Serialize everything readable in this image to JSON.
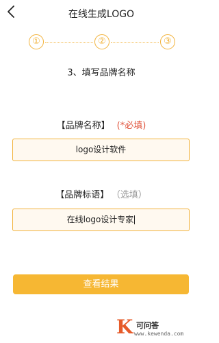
{
  "header": {
    "title": "在线生成LOGO",
    "back_icon": "chevron-left-icon"
  },
  "steps": {
    "items": [
      "①",
      "②",
      "③"
    ],
    "accent_color": "#f2b23a"
  },
  "step_title": "3、填写品牌名称",
  "brand_name": {
    "label": "【品牌名称】",
    "required_note": "(*必填)",
    "value": "logo设计软件"
  },
  "brand_slogan": {
    "label": "【品牌标语】",
    "optional_note": "（选填）",
    "value": "在线logo设计专家"
  },
  "submit": {
    "label": "查看结果",
    "color": "#f6b733"
  },
  "watermark": {
    "logo_letter": "K",
    "name": "可问答",
    "url": "www.kewenda.com"
  }
}
